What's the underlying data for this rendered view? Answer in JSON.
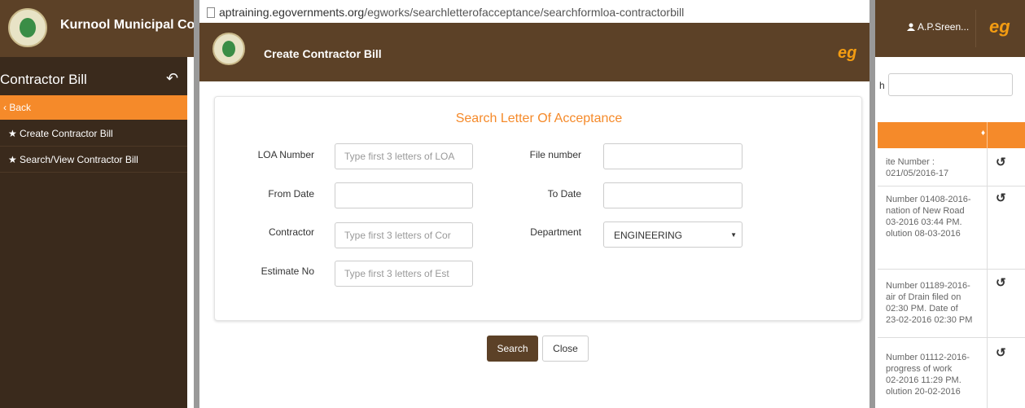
{
  "background": {
    "header_title": "Kurnool Municipal Co",
    "user_name": "A.P.Sreen...",
    "brand_mark": "eg",
    "sidebar": {
      "title": "Contractor Bill",
      "back_label": "‹ Back",
      "items": [
        {
          "label": "Create Contractor Bill",
          "icon": "star-icon"
        },
        {
          "label": "Search/View Contractor Bill",
          "icon": "star-icon"
        }
      ]
    },
    "right_panel": {
      "search_label": "h",
      "rows": [
        "ite Number :\n021/05/2016-17",
        "Number 01408-2016-\nnation of New Road\n03-2016 03:44 PM.\nolution 08-03-2016",
        "Number 01189-2016-\nair of Drain filed on\n02:30 PM. Date of\n23-02-2016 02:30 PM",
        "Number 01112-2016-\nprogress of work\n02-2016 11:29 PM.\nolution 20-02-2016"
      ]
    }
  },
  "popup": {
    "url_domain": "aptraining.egovernments.org",
    "url_path": "/egworks/searchletterofacceptance/searchformloa-contractorbill",
    "header_title": "Create Contractor Bill",
    "brand_mark": "eg",
    "form": {
      "title": "Search Letter Of Acceptance",
      "loa_number": {
        "label": "LOA Number",
        "placeholder": "Type first 3 letters of LOA"
      },
      "file_number": {
        "label": "File number",
        "value": ""
      },
      "from_date": {
        "label": "From Date",
        "value": ""
      },
      "to_date": {
        "label": "To Date",
        "value": ""
      },
      "contractor": {
        "label": "Contractor",
        "placeholder": "Type first 3 letters of Cor"
      },
      "department": {
        "label": "Department",
        "value": "ENGINEERING"
      },
      "estimate_no": {
        "label": "Estimate No",
        "placeholder": "Type first 3 letters of Est"
      }
    },
    "buttons": {
      "search": "Search",
      "close": "Close"
    }
  },
  "colors": {
    "brand_brown": "#5c4127",
    "accent_orange": "#f58a2a",
    "sidebar_dark": "#3a2a1c"
  }
}
